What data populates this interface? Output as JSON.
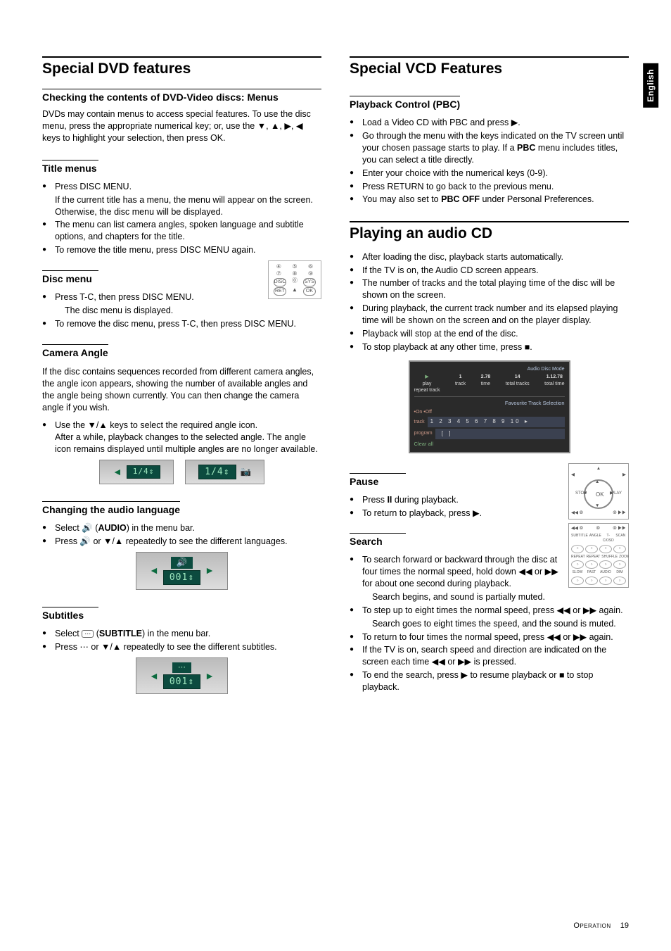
{
  "side_label": "English",
  "footer": {
    "section": "Operation",
    "page": "19"
  },
  "left": {
    "h1": "Special DVD features",
    "checking": {
      "h2": "Checking the contents of DVD-Video discs: Menus",
      "p": "DVDs may contain menus to access special features. To use the disc menu, press the appropriate numerical key; or, use the ▼, ▲, ▶, ◀ keys to highlight your selection, then press OK."
    },
    "title_menus": {
      "h2": "Title menus",
      "li1": "Press DISC MENU.",
      "li1b": "If the current title has a menu, the menu will appear on the screen. Otherwise, the disc menu will be displayed.",
      "li2": "The menu can list camera angles, spoken language and subtitle options, and chapters for the title.",
      "li3": "To remove the title menu, press DISC MENU again."
    },
    "disc_menu": {
      "h2": "Disc menu",
      "li1": "Press T-C, then press DISC MENU.",
      "li1b": "The disc menu is displayed.",
      "li2": "To remove the disc menu, press T-C, then press DISC MENU."
    },
    "camera": {
      "h2": "Camera Angle",
      "p": "If the disc contains sequences recorded from different camera angles, the angle icon appears, showing the number of available angles and the angle being shown currently. You can then change the camera angle if you wish.",
      "li1": "Use the ▼/▲ keys to select the required angle icon.",
      "li1b": "After a while, playback changes to the selected angle. The angle icon remains displayed until multiple angles are no longer available.",
      "lcd1": "1/4⇕",
      "lcd2": "1/4⇕"
    },
    "audio_lang": {
      "h2": "Changing the audio language",
      "li1_a": "Select ",
      "li1_b": " (",
      "li1_bold": "AUDIO",
      "li1_c": ") in the menu bar.",
      "li2": "Press 🔊 or ▼/▲ repeatedly to see the different languages.",
      "lcd": "001⇕"
    },
    "subtitles": {
      "h2": "Subtitles",
      "li1_a": "Select ",
      "li1_b": " (",
      "li1_bold": "SUBTITLE",
      "li1_c": ") in the menu bar.",
      "li2": "Press ⋯ or ▼/▲ repeatedly to see the different subtitles.",
      "lcd": "001⇕"
    }
  },
  "right": {
    "h1a": "Special VCD Features",
    "pbc": {
      "h2": "Playback Control (PBC)",
      "li1": "Load a Video CD with PBC and press ▶.",
      "li2_a": "Go through the menu with the keys indicated on the TV screen until your chosen passage starts to play. If a ",
      "li2_bold": "PBC",
      "li2_b": " menu includes titles, you can select a title directly.",
      "li3": "Enter your choice with the numerical keys (0-9).",
      "li4": "Press RETURN to go back to the previous menu.",
      "li5_a": "You may also set to ",
      "li5_bold": "PBC OFF",
      "li5_b": " under Personal Preferences."
    },
    "h1b": "Playing an audio CD",
    "audio_cd": {
      "li1": "After loading the disc, playback starts automatically.",
      "li2": "If the TV is on, the Audio CD screen appears.",
      "li3": "The number of tracks and the total playing time of the disc will be shown on the screen.",
      "li4": "During playback, the current track number and its elapsed playing time will be shown on the screen and on the player display.",
      "li5": "Playback will stop at the end of the disc.",
      "li6": "To stop playback at any other time, press ■."
    },
    "screenshot": {
      "mode": "Audio Disc Mode",
      "play": "play",
      "repeat": "repeat track",
      "track_n": "1",
      "track_l": "track",
      "time_n": "2.78",
      "time_l": "time",
      "total_n": "14",
      "total_l": "total tracks",
      "ttime_n": "1.12.78",
      "ttime_l": "total time",
      "fts": "Favourite Track Selection",
      "onoff": "•On •Off",
      "track": "track",
      "nums": "1 2 3 4 5 6 7 8 9 10 ▸",
      "program": "program",
      "clear": "Clear all"
    },
    "pause": {
      "h2": "Pause",
      "li1_a": "Press ",
      "li1_bold": "II",
      "li1_b": " during playback.",
      "li2": "To return to playback, press ▶."
    },
    "search": {
      "h2": "Search",
      "li1": "To search forward or backward through the disc at four times the normal speed, hold down ◀◀ or ▶▶ for about one second during playback.",
      "li1b": "Search begins, and sound is partially muted.",
      "li2": "To step up to eight times the normal speed, press ◀◀ or ▶▶ again.",
      "li2b": "Search goes to eight times the speed, and the sound is muted.",
      "li3": "To return to four times the normal speed, press ◀◀ or ▶▶ again.",
      "li4": "If the TV is on, search speed and direction are indicated on the screen each time ◀◀ or ▶▶ is pressed.",
      "li5": "To end the search, press ▶ to resume playback or ■ to stop playback."
    }
  }
}
